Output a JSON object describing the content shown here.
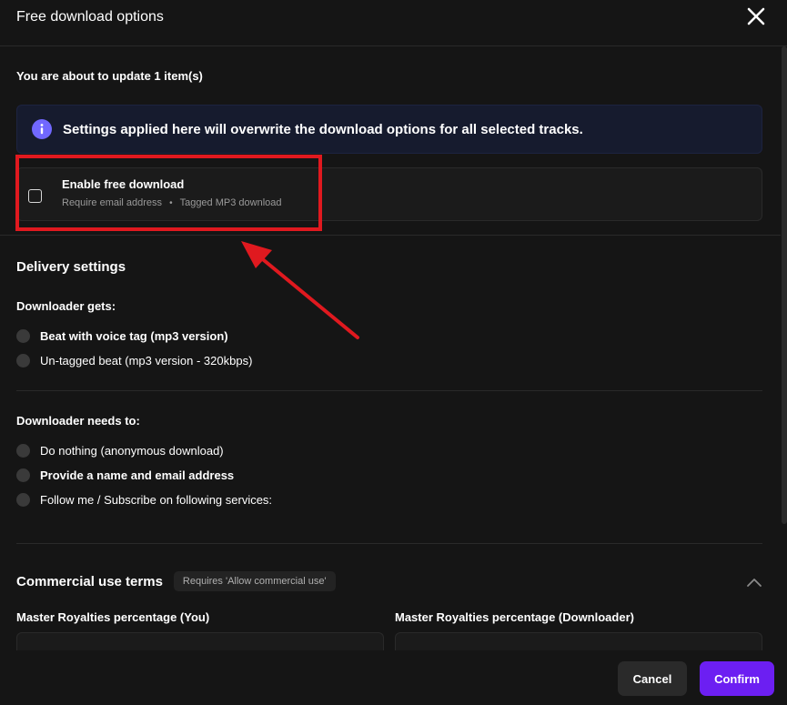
{
  "header": {
    "title": "Free download options",
    "close_icon": "close-icon"
  },
  "update_info": "You are about to update 1 item(s)",
  "banner": {
    "icon": "info-icon",
    "text": "Settings applied here will overwrite the download options for all selected tracks.",
    "icon_color": "#7168ff"
  },
  "enable": {
    "title": "Enable free download",
    "sub_email": "Require email address",
    "sub_sep": "•",
    "sub_mp3": "Tagged MP3 download",
    "checked": false
  },
  "delivery": {
    "heading": "Delivery settings",
    "gets_label": "Downloader gets:",
    "gets_options": [
      "Beat with voice tag (mp3 version)",
      "Un-tagged beat (mp3 version - 320kbps)"
    ],
    "needs_label": "Downloader needs to:",
    "needs_options": [
      "Do nothing (anonymous download)",
      "Provide a name and email address",
      "Follow me / Subscribe on following services:"
    ]
  },
  "commercial": {
    "heading": "Commercial use terms",
    "badge": "Requires 'Allow commercial use'",
    "master_you_label": "Master Royalties percentage (You)",
    "master_downloader_label": "Master Royalties percentage (Downloader)"
  },
  "footer": {
    "cancel": "Cancel",
    "confirm": "Confirm",
    "confirm_color": "#6c1ff2"
  },
  "annotation_color": "#e0191f"
}
